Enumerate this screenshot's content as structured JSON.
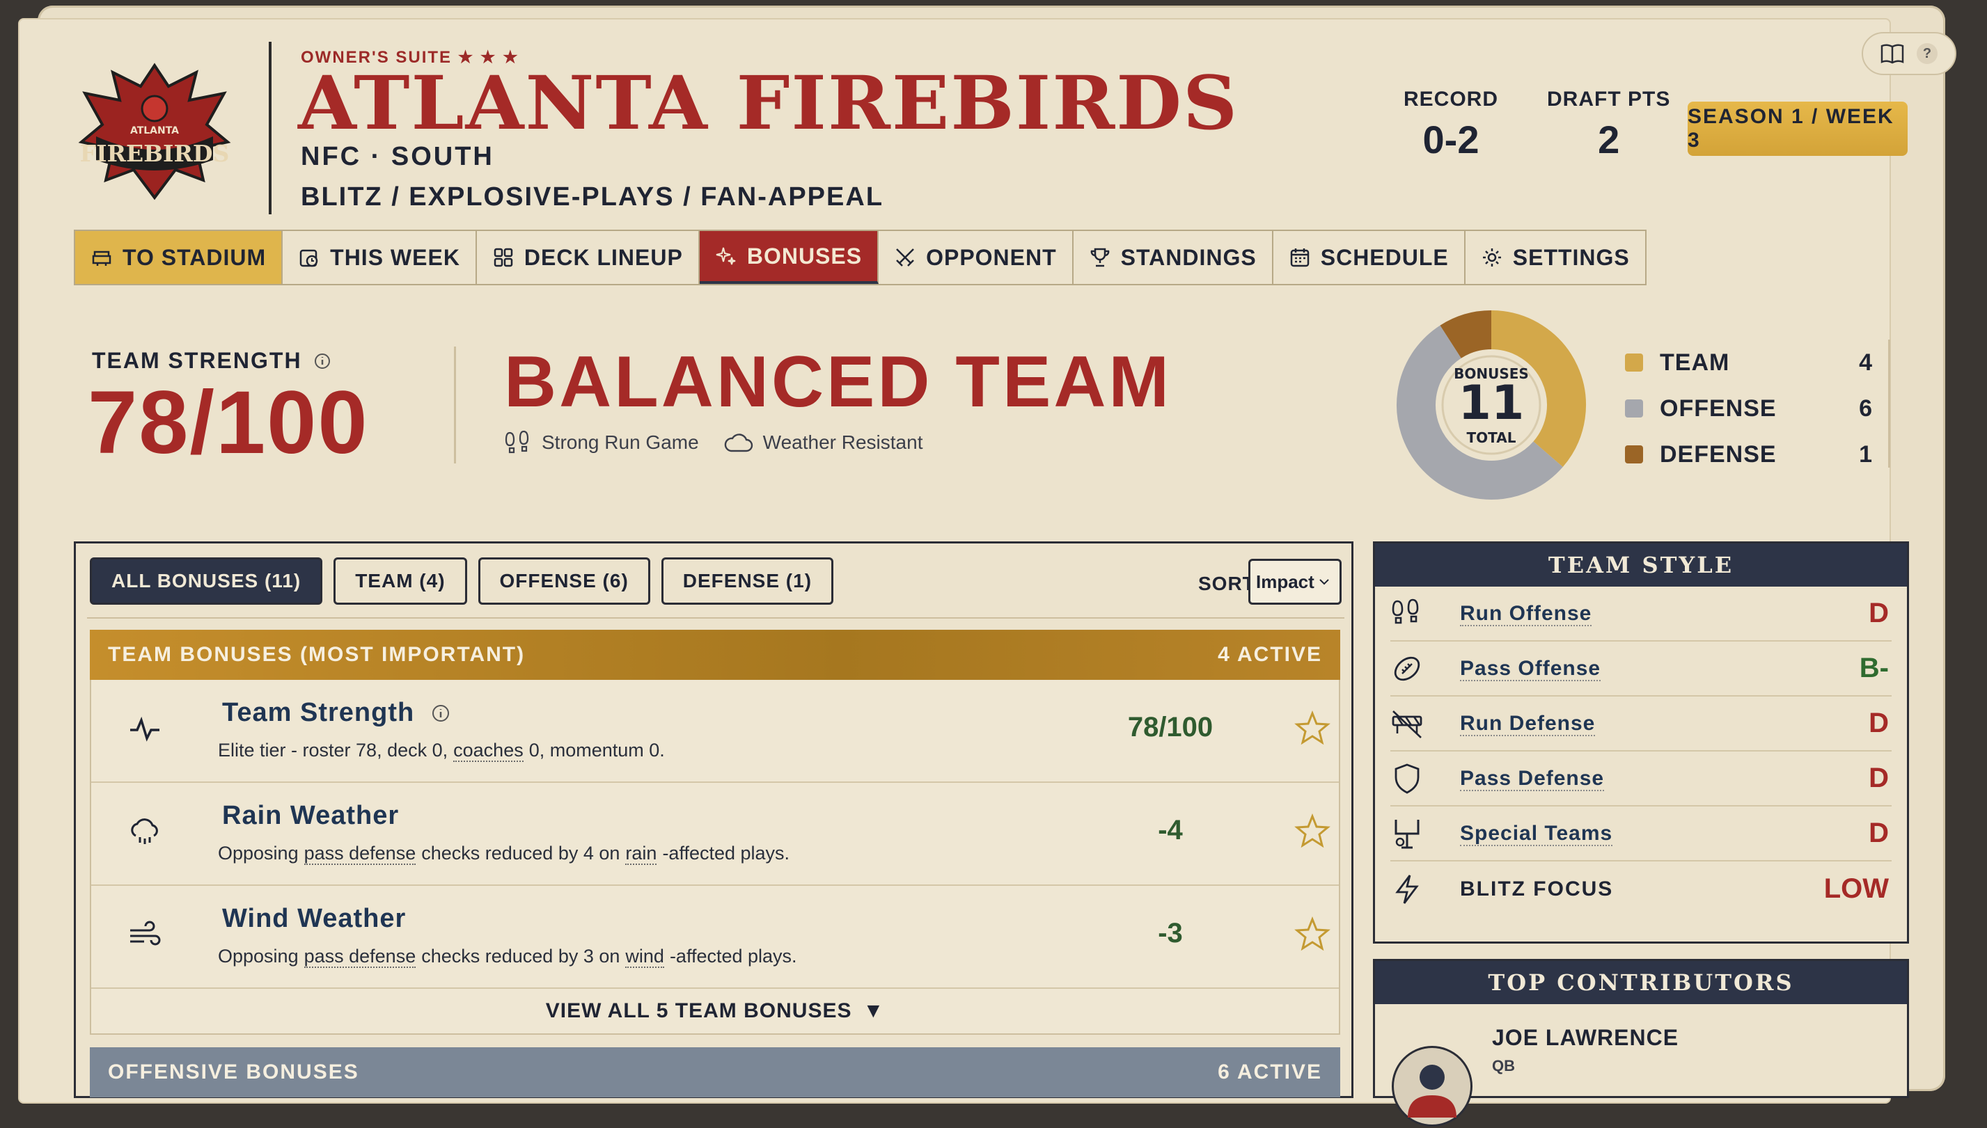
{
  "header": {
    "owner_label": "OWNER'S SUITE ★ ★ ★",
    "team_name": "ATLANTA FIREBIRDS",
    "conference": "NFC · SOUTH",
    "team_style": "BLITZ / EXPLOSIVE-PLAYS / FAN-APPEAL",
    "logo_top": "ATLANTA",
    "logo_text": "FIREBIRDS",
    "record_label": "RECORD",
    "record_value": "0-2",
    "draft_label": "DRAFT PTS",
    "draft_value": "2",
    "season_button": "SEASON 1 / WEEK 3",
    "help_icon": "?"
  },
  "nav": [
    {
      "label": "TO STADIUM",
      "icon": "stadium-icon"
    },
    {
      "label": "THIS WEEK",
      "icon": "clock-calendar-icon"
    },
    {
      "label": "DECK LINEUP",
      "icon": "grid-icon"
    },
    {
      "label": "BONUSES",
      "icon": "sparkle-icon"
    },
    {
      "label": "OPPONENT",
      "icon": "crossed-swords-icon"
    },
    {
      "label": "STANDINGS",
      "icon": "trophy-icon"
    },
    {
      "label": "SCHEDULE",
      "icon": "calendar-icon"
    },
    {
      "label": "SETTINGS",
      "icon": "gear-icon"
    }
  ],
  "strength": {
    "label": "TEAM STRENGTH",
    "value": "78/100",
    "headline": "BALANCED TEAM",
    "traits": [
      "Strong Run Game",
      "Weather Resistant"
    ]
  },
  "chart_data": {
    "type": "pie",
    "categories": [
      "TEAM",
      "OFFENSE",
      "DEFENSE"
    ],
    "values": [
      4,
      6,
      1
    ],
    "center_top": "BONUSES",
    "center_value": "11",
    "center_bottom": "TOTAL",
    "colors": [
      "#d3a84a",
      "#a5a7ad",
      "#9b6526"
    ]
  },
  "bonuses": {
    "tabs": [
      "ALL BONUSES (11)",
      "TEAM (4)",
      "OFFENSE (6)",
      "DEFENSE (1)"
    ],
    "sort_label": "SORT",
    "sort_value": "Impact",
    "team_section_title": "TEAM BONUSES (MOST IMPORTANT)",
    "team_section_count": "4 ACTIVE",
    "rows": [
      {
        "name": "Team Strength",
        "desc_parts": [
          "Elite tier - roster 78, deck 0,",
          "coaches",
          "0, momentum 0."
        ],
        "value": "78/100"
      },
      {
        "name": "Rain Weather",
        "desc_parts": [
          "Opposing",
          "pass defense",
          "checks reduced by 4 on",
          "rain",
          "-affected plays."
        ],
        "value": "-4"
      },
      {
        "name": "Wind Weather",
        "desc_parts": [
          "Opposing",
          "pass defense",
          "checks reduced by 3 on",
          "wind",
          "-affected plays."
        ],
        "value": "-3"
      }
    ],
    "view_all": "VIEW ALL 5 TEAM BONUSES",
    "view_all_arrow": "▼",
    "off_section_title": "OFFENSIVE BONUSES",
    "off_section_count": "6 ACTIVE"
  },
  "team_style_card": {
    "title": "TEAM STYLE",
    "rows": [
      {
        "name": "Run Offense",
        "grade": "D"
      },
      {
        "name": "Pass Offense",
        "grade": "B-"
      },
      {
        "name": "Run Defense",
        "grade": "D"
      },
      {
        "name": "Pass Defense",
        "grade": "D"
      },
      {
        "name": "Special Teams",
        "grade": "D"
      },
      {
        "name": "BLITZ FOCUS",
        "grade": "LOW"
      }
    ]
  },
  "contributors": {
    "title": "TOP CONTRIBUTORS",
    "player_name": "JOE LAWRENCE",
    "player_pos": "QB"
  }
}
